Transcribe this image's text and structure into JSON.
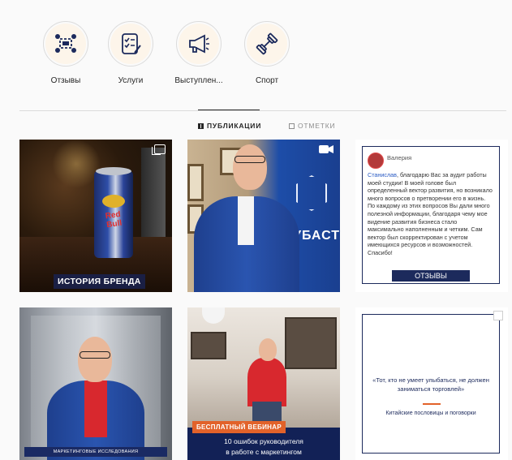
{
  "highlights": [
    {
      "label": "Отзывы",
      "icon": "users-review-icon"
    },
    {
      "label": "Услуги",
      "icon": "checklist-icon"
    },
    {
      "label": "Выступлен...",
      "icon": "megaphone-icon"
    },
    {
      "label": "Спорт",
      "icon": "dumbbell-icon"
    }
  ],
  "tabs": {
    "publications": "ПУБЛИКАЦИИ",
    "tagged": "ОТМЕТКИ"
  },
  "posts": {
    "p1": {
      "caption": "ИСТОРИЯ БРЕНДА",
      "can_text": "Red Bull"
    },
    "p2": {
      "brand_text": "ЗУБАСТ"
    },
    "p3": {
      "reviewer": "Валерия",
      "mention": "Станислав",
      "text": ", благодарю Вас за аудит работы моей студии! В моей голове был определенный вектор развития, но возникало много вопросов о претворении его в жизнь. По каждому из этих вопросов Вы дали много полезной информации, благодаря чему мое видение развития бизнеса стало максимально наполненным и четким. Сам вектор был скорректирован с учетом имеющихся ресурсов и возможностей. Спасибо!",
      "button": "ОТЗЫВЫ"
    },
    "p4": {
      "caption": "МАРКЕТИНГОВЫЕ ИССЛЕДОВАНИЯ"
    },
    "p5": {
      "tag": "БЕСПЛАТНЫЙ ВЕБИНАР",
      "line1": "10 ошибок руководителя",
      "line2": "в работе с маркетингом"
    },
    "p6": {
      "quote": "«Тот, кто не умеет улыбаться, не должен заниматься торговлей»",
      "source": "Китайские пословицы и поговорки"
    }
  },
  "colors": {
    "navy": "#1c2a5c",
    "accent_orange": "#e2622a",
    "mention_blue": "#2a5bc4"
  }
}
